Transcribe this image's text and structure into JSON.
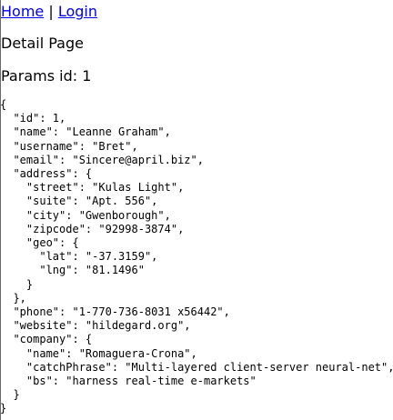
{
  "nav": {
    "home_label": "Home",
    "separator": " | ",
    "login_label": "Login"
  },
  "page_title": "Detail Page",
  "params_text": "Params id: 1",
  "json_text": "{\n  \"id\": 1,\n  \"name\": \"Leanne Graham\",\n  \"username\": \"Bret\",\n  \"email\": \"Sincere@april.biz\",\n  \"address\": {\n    \"street\": \"Kulas Light\",\n    \"suite\": \"Apt. 556\",\n    \"city\": \"Gwenborough\",\n    \"zipcode\": \"92998-3874\",\n    \"geo\": {\n      \"lat\": \"-37.3159\",\n      \"lng\": \"81.1496\"\n    }\n  },\n  \"phone\": \"1-770-736-8031 x56442\",\n  \"website\": \"hildegard.org\",\n  \"company\": {\n    \"name\": \"Romaguera-Crona\",\n    \"catchPhrase\": \"Multi-layered client-server neural-net\",\n    \"bs\": \"harness real-time e-markets\"\n  }\n}"
}
